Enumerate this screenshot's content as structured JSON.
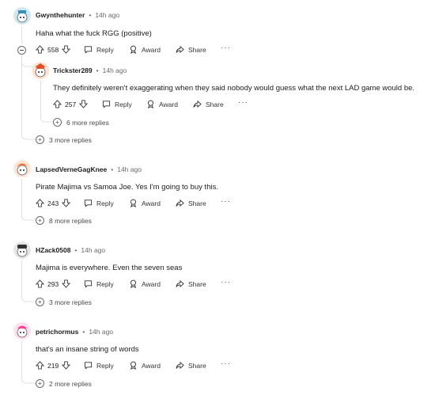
{
  "comments": [
    {
      "username": "Gwynthehunter",
      "time": "14h ago",
      "text": "Haha what the fuck RGG (positive)",
      "votes": "558",
      "avatar_color": "#b0d7e8"
    },
    {
      "username": "Trickster289",
      "time": "14h ago",
      "text": "They definitely weren't exaggerating when they said nobody would guess what the next LAD game would be.",
      "votes": "257",
      "more_replies": "6 more replies",
      "avatar_color": "#e86a3a"
    },
    {
      "more_replies": "3 more replies"
    },
    {
      "username": "LapsedVerneGagKnee",
      "time": "14h ago",
      "text": "Pirate Majima vs Samoa Joe.  Yes I'm going to buy this.",
      "votes": "243",
      "more_replies": "8 more replies",
      "avatar_color": "#ff7a45"
    },
    {
      "username": "HZack0508",
      "time": "14h ago",
      "text": "Majima is everywhere. Even the seven seas",
      "votes": "293",
      "more_replies": "3 more replies",
      "avatar_color": "#8a8a8a"
    },
    {
      "username": "petrichormus",
      "time": "14h ago",
      "text": "that's an insane string of words",
      "votes": "219",
      "more_replies": "2 more replies",
      "avatar_color": "#ff4fa3"
    }
  ],
  "actions": {
    "reply": "Reply",
    "award": "Award",
    "share": "Share",
    "more": "···"
  },
  "separator": "•"
}
